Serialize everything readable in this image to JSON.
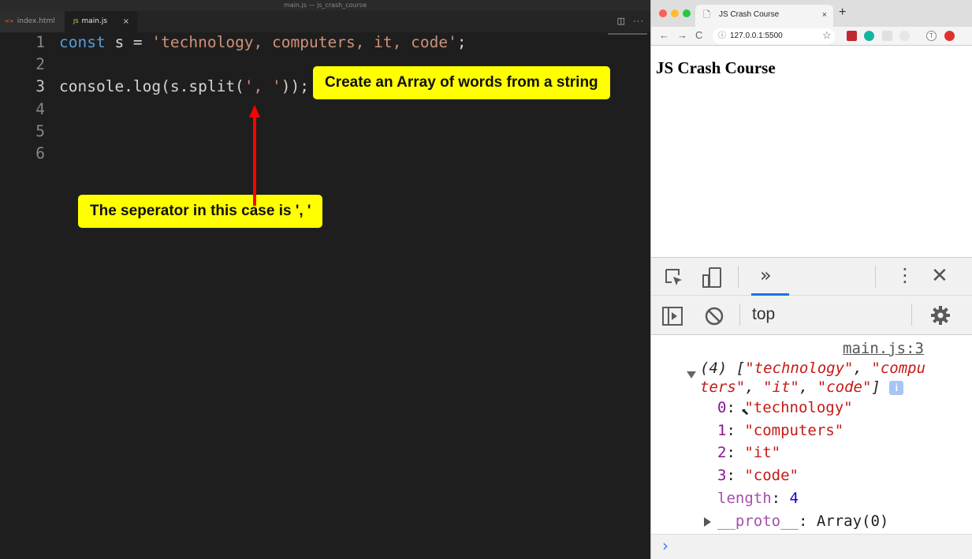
{
  "editor": {
    "window_title": "main.js — js_crash_course",
    "tabs": [
      {
        "icon": "<>",
        "label": "index.html"
      },
      {
        "icon": "JS",
        "label": "main.js",
        "close": "×"
      }
    ],
    "toolbar": {
      "split": "◫",
      "more": "···"
    },
    "lines": [
      {
        "num": "1",
        "tokens": [
          {
            "t": "const",
            "c": "kw"
          },
          {
            "t": " s = ",
            "c": "var"
          },
          {
            "t": "'technology, computers, it, code'",
            "c": "str"
          },
          {
            "t": ";",
            "c": "var"
          }
        ]
      },
      {
        "num": "2",
        "tokens": []
      },
      {
        "num": "3",
        "tokens": [
          {
            "t": "console.log(s.split(",
            "c": "var"
          },
          {
            "t": "', '",
            "c": "str"
          },
          {
            "t": "));",
            "c": "var"
          }
        ]
      },
      {
        "num": "4",
        "tokens": []
      },
      {
        "num": "5",
        "tokens": []
      },
      {
        "num": "6",
        "tokens": []
      }
    ],
    "active_line": "3"
  },
  "callouts": {
    "array": "Create an Array of words from a string",
    "separator": "The seperator in this case is ', '"
  },
  "colors": {
    "callout_bg": "#ffff00",
    "arrow": "#ff0000"
  },
  "browser": {
    "tab_title": "JS Crash Course",
    "tab_close": "×",
    "new_tab": "+",
    "nav": {
      "back": "←",
      "forward": "→",
      "reload": "C"
    },
    "url": "127.0.0.1:5500",
    "info": "ⓘ",
    "star": "☆",
    "ext_t": "T",
    "page_heading": "JS Crash Course"
  },
  "devtools": {
    "more_tabs": "»",
    "kebab": "⋮",
    "close": "✕",
    "context": "top",
    "console": {
      "source": "main.js:3",
      "count": "(4)",
      "preview": {
        "open": " [",
        "items": [
          "\"technology\"",
          "\"computers\"",
          "\"it\"",
          "\"code\""
        ],
        "close": "]"
      },
      "info_badge": "i",
      "entries": [
        {
          "key": "0",
          "value": "\"technology\""
        },
        {
          "key": "1",
          "value": "\"computers\""
        },
        {
          "key": "2",
          "value": "\"it\""
        },
        {
          "key": "3",
          "value": "\"code\""
        }
      ],
      "length_key": "length",
      "length_value": "4",
      "proto_key": "__proto__",
      "proto_value": "Array(0)",
      "prompt": "›"
    }
  }
}
